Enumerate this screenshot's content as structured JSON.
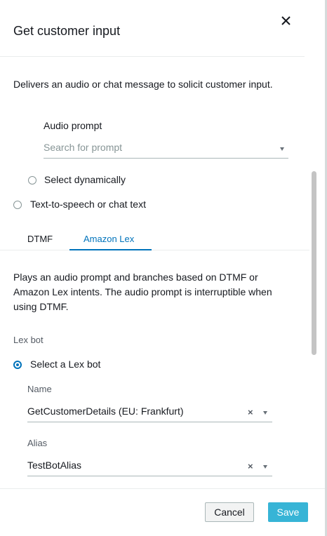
{
  "header": {
    "title": "Get customer input",
    "close_icon": "close-icon"
  },
  "description": "Delivers an audio or chat message to solicit customer input.",
  "audio_prompt": {
    "label": "Audio prompt",
    "search_placeholder": "Search for prompt",
    "select_dynamically_label": "Select dynamically",
    "select_dynamically_checked": false
  },
  "tts_option": {
    "label": "Text-to-speech or chat text",
    "checked": false
  },
  "tabs": [
    {
      "label": "DTMF",
      "active": false
    },
    {
      "label": "Amazon Lex",
      "active": true
    }
  ],
  "lex_description": "Plays an audio prompt and branches based on DTMF or Amazon Lex intents. The audio prompt is interruptible when using DTMF.",
  "lex_bot": {
    "section_label": "Lex bot",
    "select_option_label": "Select a Lex bot",
    "select_option_checked": true,
    "name_label": "Name",
    "name_value": "GetCustomerDetails (EU: Frankfurt)",
    "alias_label": "Alias",
    "alias_value": "TestBotAlias"
  },
  "footer": {
    "cancel_label": "Cancel",
    "save_label": "Save"
  },
  "colors": {
    "accent": "#0073bb",
    "save_button": "#37b4d6"
  }
}
